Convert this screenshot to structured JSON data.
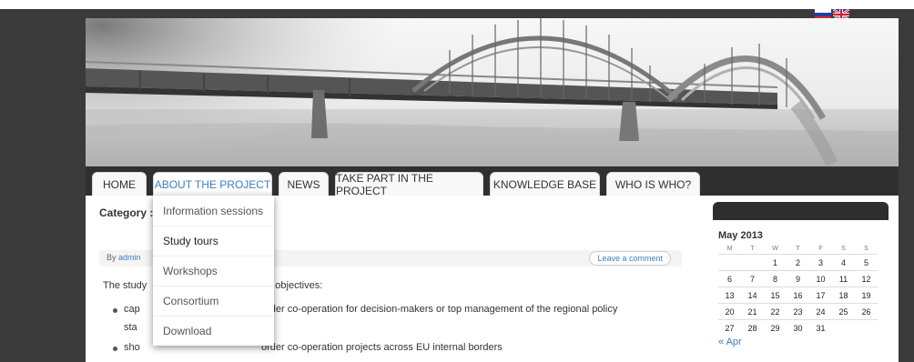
{
  "nav": {
    "tabs": [
      {
        "label": "HOME"
      },
      {
        "label": "ABOUT THE PROJECT"
      },
      {
        "label": "NEWS"
      },
      {
        "label": "TAKE PART IN THE PROJECT"
      },
      {
        "label": "KNOWLEDGE BASE"
      },
      {
        "label": "WHO IS WHO?"
      }
    ],
    "active_index": 1
  },
  "dropdown": {
    "items": [
      {
        "label": "Information sessions"
      },
      {
        "label": "Study tours"
      },
      {
        "label": "Workshops"
      },
      {
        "label": "Consortium"
      },
      {
        "label": "Download"
      }
    ]
  },
  "post": {
    "category": "Category :",
    "by_label": "By",
    "author": "admin",
    "comment_button": "Leave a comment",
    "intro_left": "The study",
    "intro_right": "ng objectives:",
    "bullet1_left": "cap",
    "bullet1_right": "order co-operation for decision-makers or top management of the regional policy",
    "bullet1_cont": "sta",
    "bullet2_left": "sho",
    "bullet2_right": "order co-operation projects across EU internal borders"
  },
  "calendar": {
    "caption": "May 2013",
    "weekdays": [
      "M",
      "T",
      "W",
      "T",
      "F",
      "S",
      "S"
    ],
    "weeks": [
      [
        "",
        "",
        "1",
        "2",
        "3",
        "4",
        "5"
      ],
      [
        "6",
        "7",
        "8",
        "9",
        "10",
        "11",
        "12"
      ],
      [
        "13",
        "14",
        "15",
        "16",
        "17",
        "18",
        "19"
      ],
      [
        "20",
        "21",
        "22",
        "23",
        "24",
        "25",
        "26"
      ],
      [
        "27",
        "28",
        "29",
        "30",
        "31",
        "",
        ""
      ]
    ],
    "prev_link": "« Apr"
  },
  "flags": [
    "russian-flag-icon",
    "uk-flag-icon"
  ],
  "colors": {
    "accent": "#3a7fc0",
    "nav_bg": "#303030",
    "page_bg": "#3a3a3a"
  }
}
